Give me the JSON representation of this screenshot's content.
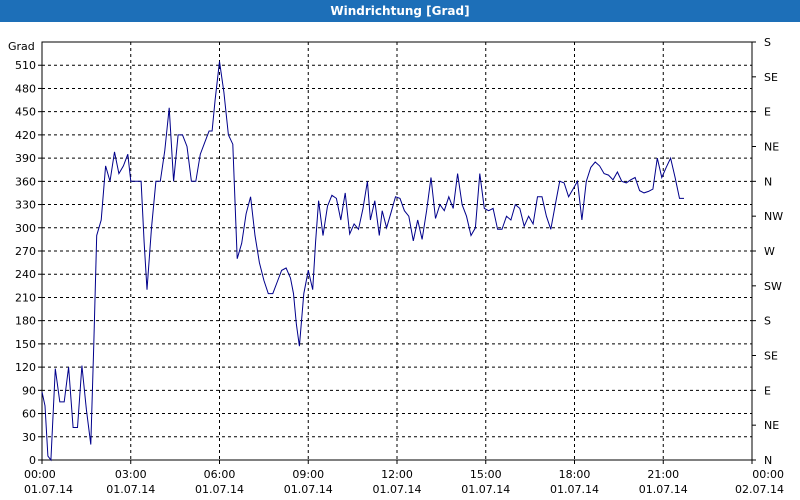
{
  "window": {
    "title": "Windrichtung [Grad]"
  },
  "chart_data": {
    "type": "line",
    "title": "Windrichtung [Grad]",
    "ylabel": "Grad",
    "ylim": [
      0,
      540
    ],
    "xlim": [
      "01.07.14 00:00",
      "02.07.14 00:00"
    ],
    "grid": true,
    "y_ticks": [
      0,
      30,
      60,
      90,
      120,
      150,
      180,
      210,
      240,
      270,
      300,
      330,
      360,
      390,
      420,
      450,
      480,
      510
    ],
    "y2_ticks": [
      {
        "value": 0,
        "label": "N"
      },
      {
        "value": 45,
        "label": "NE"
      },
      {
        "value": 90,
        "label": "E"
      },
      {
        "value": 135,
        "label": "SE"
      },
      {
        "value": 180,
        "label": "S"
      },
      {
        "value": 225,
        "label": "SW"
      },
      {
        "value": 270,
        "label": "W"
      },
      {
        "value": 315,
        "label": "NW"
      },
      {
        "value": 360,
        "label": "N"
      },
      {
        "value": 405,
        "label": "NE"
      },
      {
        "value": 450,
        "label": "E"
      },
      {
        "value": 495,
        "label": "SE"
      },
      {
        "value": 540,
        "label": "S"
      }
    ],
    "x_ticks": [
      {
        "hour": 0,
        "time": "00:00",
        "date": "01.07.14"
      },
      {
        "hour": 3,
        "time": "03:00",
        "date": "01.07.14"
      },
      {
        "hour": 6,
        "time": "06:00",
        "date": "01.07.14"
      },
      {
        "hour": 9,
        "time": "09:00",
        "date": "01.07.14"
      },
      {
        "hour": 12,
        "time": "12:00",
        "date": "01.07.14"
      },
      {
        "hour": 15,
        "time": "15:00",
        "date": "01.07.14"
      },
      {
        "hour": 18,
        "time": "18:00",
        "date": "01.07.14"
      },
      {
        "hour": 21,
        "time": "21:00",
        "date": "01.07.14"
      },
      {
        "hour": 24,
        "time": "00:00",
        "date": "02.07.14"
      }
    ],
    "series": [
      {
        "color": "#00008b",
        "points": [
          [
            0.0,
            88
          ],
          [
            0.1,
            70
          ],
          [
            0.2,
            5
          ],
          [
            0.3,
            0
          ],
          [
            0.45,
            118
          ],
          [
            0.6,
            75
          ],
          [
            0.75,
            75
          ],
          [
            0.9,
            120
          ],
          [
            1.05,
            42
          ],
          [
            1.2,
            42
          ],
          [
            1.35,
            122
          ],
          [
            1.5,
            65
          ],
          [
            1.65,
            20
          ],
          [
            1.75,
            150
          ],
          [
            1.85,
            290
          ],
          [
            2.0,
            310
          ],
          [
            2.15,
            380
          ],
          [
            2.3,
            360
          ],
          [
            2.45,
            398
          ],
          [
            2.6,
            370
          ],
          [
            2.75,
            380
          ],
          [
            2.9,
            395
          ],
          [
            3.0,
            360
          ],
          [
            3.2,
            360
          ],
          [
            3.35,
            360
          ],
          [
            3.45,
            282
          ],
          [
            3.55,
            220
          ],
          [
            3.7,
            300
          ],
          [
            3.85,
            360
          ],
          [
            4.0,
            360
          ],
          [
            4.15,
            400
          ],
          [
            4.3,
            455
          ],
          [
            4.45,
            360
          ],
          [
            4.6,
            420
          ],
          [
            4.75,
            420
          ],
          [
            4.9,
            405
          ],
          [
            5.05,
            360
          ],
          [
            5.2,
            360
          ],
          [
            5.35,
            395
          ],
          [
            5.5,
            410
          ],
          [
            5.65,
            425
          ],
          [
            5.75,
            425
          ],
          [
            5.85,
            465
          ],
          [
            6.0,
            515
          ],
          [
            6.15,
            475
          ],
          [
            6.3,
            420
          ],
          [
            6.45,
            408
          ],
          [
            6.6,
            260
          ],
          [
            6.75,
            280
          ],
          [
            6.9,
            318
          ],
          [
            7.05,
            340
          ],
          [
            7.2,
            290
          ],
          [
            7.35,
            255
          ],
          [
            7.5,
            232
          ],
          [
            7.65,
            215
          ],
          [
            7.8,
            215
          ],
          [
            7.95,
            230
          ],
          [
            8.1,
            245
          ],
          [
            8.25,
            248
          ],
          [
            8.4,
            235
          ],
          [
            8.5,
            215
          ],
          [
            8.6,
            175
          ],
          [
            8.7,
            147
          ],
          [
            8.85,
            215
          ],
          [
            9.0,
            245
          ],
          [
            9.15,
            220
          ],
          [
            9.25,
            282
          ],
          [
            9.35,
            335
          ],
          [
            9.5,
            290
          ],
          [
            9.65,
            328
          ],
          [
            9.8,
            342
          ],
          [
            9.95,
            338
          ],
          [
            10.1,
            310
          ],
          [
            10.25,
            345
          ],
          [
            10.4,
            292
          ],
          [
            10.55,
            305
          ],
          [
            10.7,
            298
          ],
          [
            10.85,
            325
          ],
          [
            11.0,
            360
          ],
          [
            11.1,
            310
          ],
          [
            11.25,
            335
          ],
          [
            11.4,
            290
          ],
          [
            11.5,
            322
          ],
          [
            11.65,
            300
          ],
          [
            11.8,
            320
          ],
          [
            11.95,
            340
          ],
          [
            12.1,
            338
          ],
          [
            12.25,
            322
          ],
          [
            12.4,
            315
          ],
          [
            12.55,
            283
          ],
          [
            12.7,
            310
          ],
          [
            12.85,
            285
          ],
          [
            13.0,
            322
          ],
          [
            13.15,
            365
          ],
          [
            13.3,
            312
          ],
          [
            13.45,
            330
          ],
          [
            13.6,
            322
          ],
          [
            13.75,
            340
          ],
          [
            13.9,
            325
          ],
          [
            14.05,
            370
          ],
          [
            14.2,
            330
          ],
          [
            14.35,
            315
          ],
          [
            14.5,
            290
          ],
          [
            14.65,
            300
          ],
          [
            14.8,
            370
          ],
          [
            14.95,
            325
          ],
          [
            15.1,
            322
          ],
          [
            15.25,
            325
          ],
          [
            15.4,
            298
          ],
          [
            15.55,
            298
          ],
          [
            15.7,
            315
          ],
          [
            15.85,
            310
          ],
          [
            16.0,
            330
          ],
          [
            16.15,
            325
          ],
          [
            16.3,
            302
          ],
          [
            16.45,
            315
          ],
          [
            16.6,
            305
          ],
          [
            16.75,
            340
          ],
          [
            16.9,
            340
          ],
          [
            17.05,
            315
          ],
          [
            17.2,
            298
          ],
          [
            17.35,
            330
          ],
          [
            17.5,
            360
          ],
          [
            17.65,
            358
          ],
          [
            17.8,
            340
          ],
          [
            17.95,
            350
          ],
          [
            18.1,
            360
          ],
          [
            18.25,
            310
          ],
          [
            18.4,
            360
          ],
          [
            18.55,
            378
          ],
          [
            18.7,
            385
          ],
          [
            18.85,
            380
          ],
          [
            19.0,
            370
          ],
          [
            19.15,
            368
          ],
          [
            19.3,
            362
          ],
          [
            19.45,
            372
          ],
          [
            19.6,
            360
          ],
          [
            19.75,
            358
          ],
          [
            19.9,
            362
          ],
          [
            20.05,
            365
          ],
          [
            20.2,
            348
          ],
          [
            20.35,
            345
          ],
          [
            20.5,
            347
          ],
          [
            20.65,
            350
          ],
          [
            20.8,
            390
          ],
          [
            20.95,
            365
          ],
          [
            21.1,
            378
          ],
          [
            21.25,
            390
          ],
          [
            21.4,
            365
          ],
          [
            21.55,
            338
          ],
          [
            21.7,
            338
          ]
        ]
      }
    ]
  }
}
